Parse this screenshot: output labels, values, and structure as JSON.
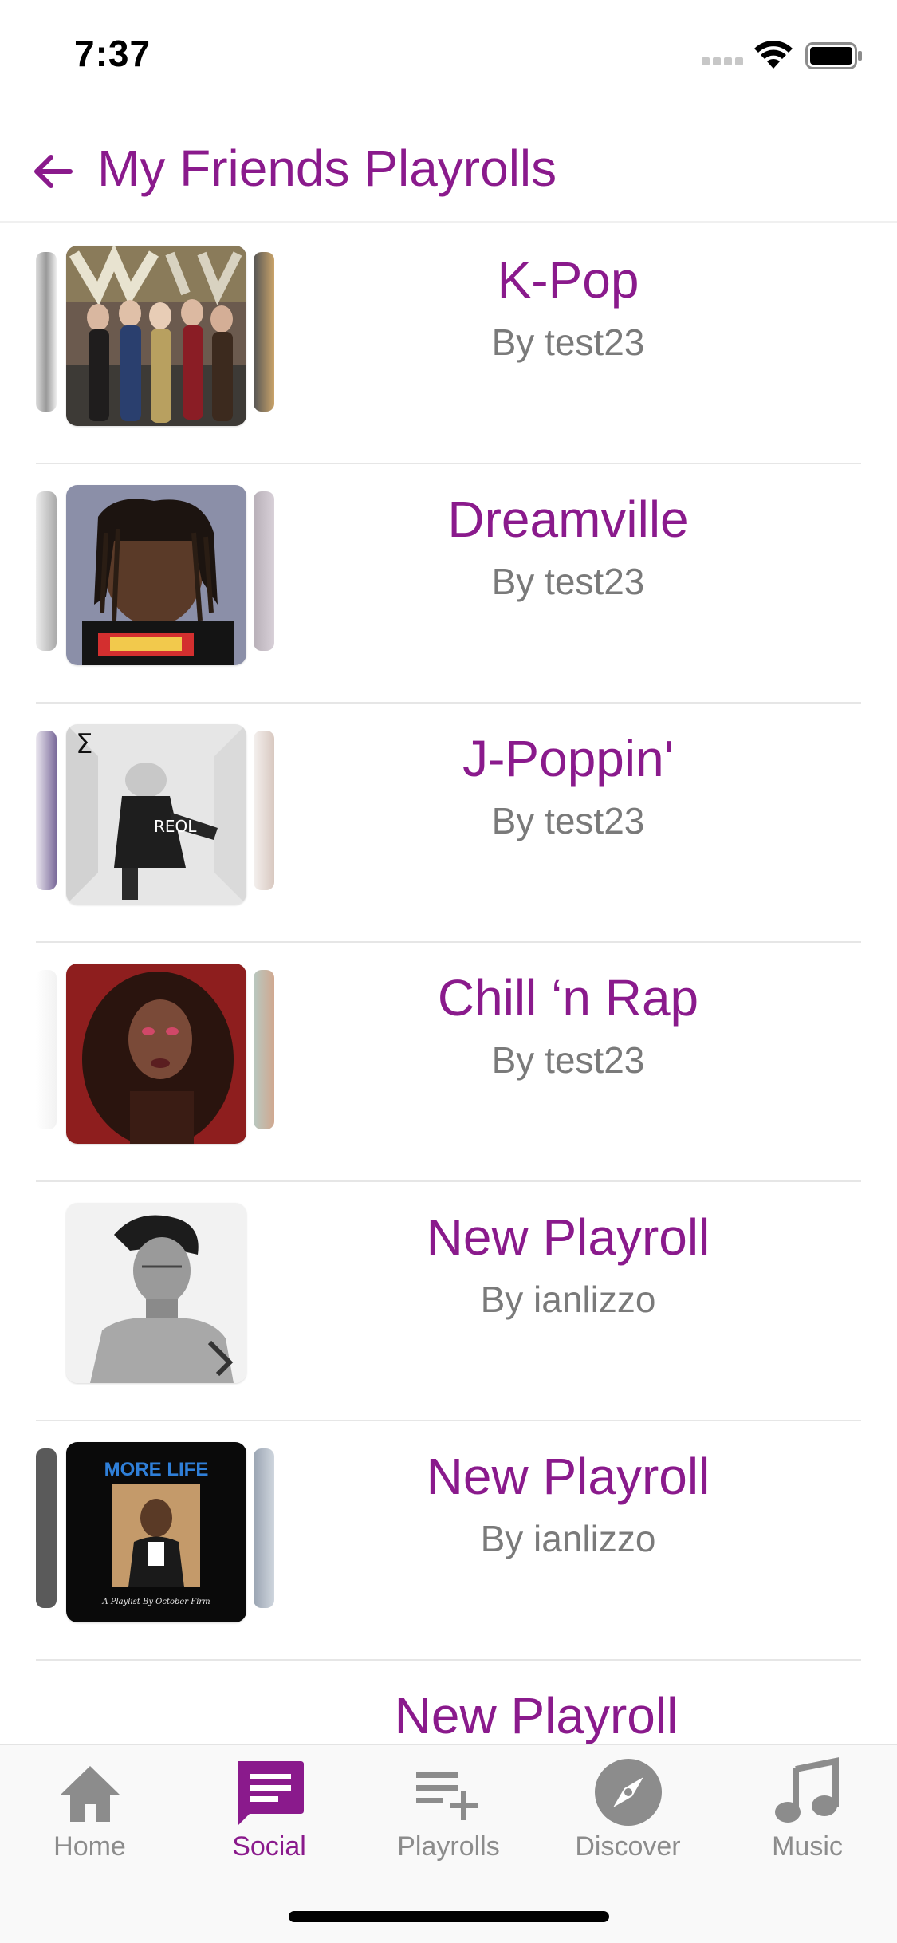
{
  "status": {
    "time": "7:37"
  },
  "header": {
    "title": "My Friends Playrolls"
  },
  "playrolls": [
    {
      "title": "K-Pop",
      "by": "By test23"
    },
    {
      "title": "Dreamville",
      "by": "By test23"
    },
    {
      "title": "J-Poppin'",
      "by": "By test23"
    },
    {
      "title": "Chill ‘n Rap",
      "by": "By test23"
    },
    {
      "title": "New Playroll",
      "by": "By ianlizzo"
    },
    {
      "title": "New Playroll",
      "by": "By ianlizzo"
    },
    {
      "title": "New Playroll",
      "by": ""
    }
  ],
  "covers": {
    "more_life_title": "MORE LIFE",
    "more_life_subtitle": "A Playlist By October Firm",
    "reol_text": "REOL",
    "sigma": "Σ"
  },
  "tabs": [
    {
      "label": "Home",
      "icon": "home-icon"
    },
    {
      "label": "Social",
      "icon": "chat-icon"
    },
    {
      "label": "Playrolls",
      "icon": "playlist-add-icon"
    },
    {
      "label": "Discover",
      "icon": "compass-icon"
    },
    {
      "label": "Music",
      "icon": "music-note-icon"
    }
  ],
  "colors": {
    "accent": "#8a1a8c",
    "inactive": "#8c8c8c",
    "subtitle": "#7a7a7a"
  }
}
